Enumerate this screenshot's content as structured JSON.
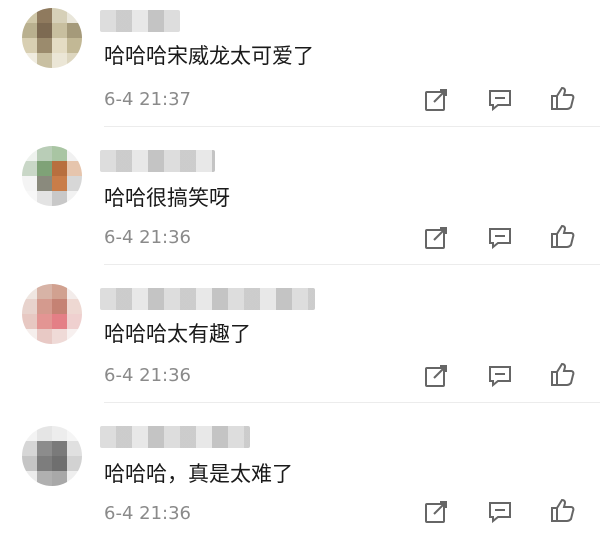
{
  "comments": [
    {
      "text": "哈哈哈宋威龙太可爱了",
      "time": "6-4 21:37"
    },
    {
      "text": "哈哈很搞笑呀",
      "time": "6-4 21:36"
    },
    {
      "text": "哈哈哈太有趣了",
      "time": "6-4 21:36"
    },
    {
      "text": "哈哈哈，真是太难了",
      "time": "6-4 21:36"
    }
  ],
  "icons": {
    "share": "share-icon",
    "reply": "comment-icon",
    "like": "thumbs-up-icon"
  },
  "colors": {
    "text": "#1a1a1a",
    "timestamp": "#8a8a8a",
    "icon": "#666666",
    "divider": "#ececec"
  }
}
